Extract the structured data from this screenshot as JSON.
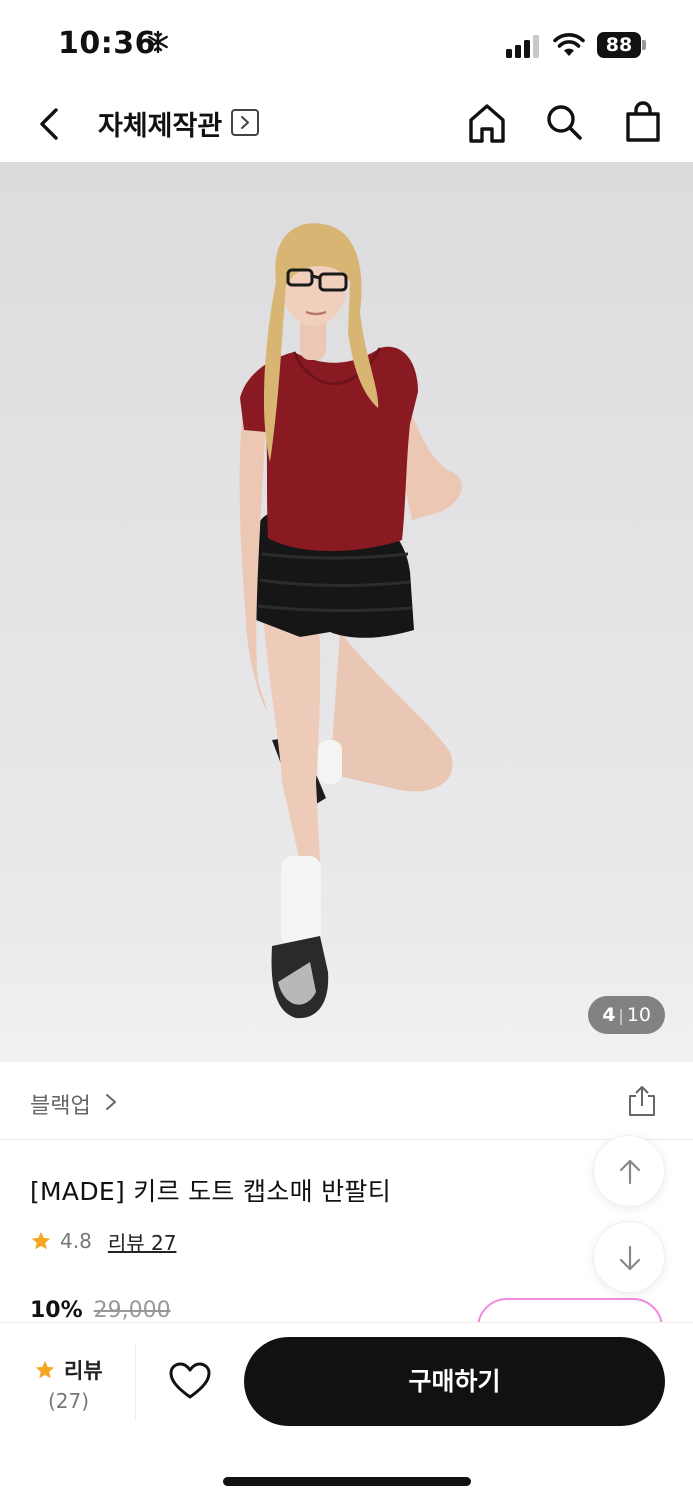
{
  "status_bar": {
    "time": "10:36",
    "battery": "88"
  },
  "nav": {
    "store_title": "자체제작관",
    "store_chevron": ">"
  },
  "gallery": {
    "current": "4",
    "separator": "|",
    "total": "10"
  },
  "brand": {
    "name": "블랙업"
  },
  "product": {
    "title": "[MADE] 키르 도트 캡소매 반팔티",
    "rating": "4.8",
    "review_link": "리뷰 27",
    "discount": "10%",
    "original_price": "29,000"
  },
  "bottom_bar": {
    "review_label": "리뷰",
    "review_count": "(27)",
    "buy_label": "구매하기"
  },
  "colors": {
    "accent_star": "#f5a623",
    "buy_button": "#111111",
    "coupon_border": "#f08be0"
  }
}
